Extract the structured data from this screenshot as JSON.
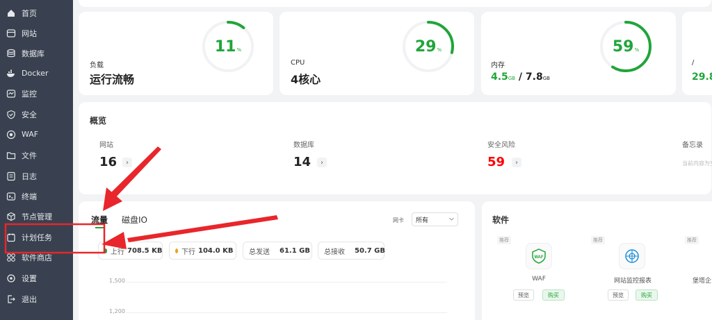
{
  "sidebar": {
    "items": [
      {
        "label": "首页",
        "icon": "home-icon"
      },
      {
        "label": "网站",
        "icon": "globe-icon"
      },
      {
        "label": "数据库",
        "icon": "database-icon"
      },
      {
        "label": "Docker",
        "icon": "docker-icon"
      },
      {
        "label": "监控",
        "icon": "monitor-icon"
      },
      {
        "label": "安全",
        "icon": "shield-icon"
      },
      {
        "label": "WAF",
        "icon": "firewall-icon"
      },
      {
        "label": "文件",
        "icon": "folder-icon"
      },
      {
        "label": "日志",
        "icon": "log-icon"
      },
      {
        "label": "终端",
        "icon": "terminal-icon"
      },
      {
        "label": "节点管理",
        "icon": "node-icon"
      },
      {
        "label": "计划任务",
        "icon": "task-icon"
      },
      {
        "label": "软件商店",
        "icon": "store-icon"
      },
      {
        "label": "设置",
        "icon": "gear-icon"
      },
      {
        "label": "退出",
        "icon": "logout-icon"
      }
    ]
  },
  "stats": {
    "load": {
      "label": "负载",
      "value": "运行流畅",
      "percent": "11",
      "unit": "%",
      "ratio": 0.11
    },
    "cpu": {
      "label": "CPU",
      "value": "4核心",
      "percent": "29",
      "unit": "%",
      "ratio": 0.29
    },
    "memory": {
      "label": "内存",
      "used": "4.5",
      "used_unit": "GB",
      "sep": " / ",
      "total": "7.8",
      "total_unit": "GB",
      "percent": "59",
      "unit": "%",
      "ratio": 0.59
    },
    "disk": {
      "label": "/",
      "value": "29.8"
    }
  },
  "overview": {
    "title": "概览",
    "items": [
      {
        "label": "网站",
        "value": "16"
      },
      {
        "label": "数据库",
        "value": "14"
      },
      {
        "label": "安全风险",
        "value": "59"
      },
      {
        "label": "备忘录",
        "hint": "当前内容为空"
      }
    ],
    "chevron": "›"
  },
  "traffic": {
    "tabs": [
      "流量",
      "磁盘IO"
    ],
    "nic_label": "网卡",
    "nic_value": "所有",
    "up_label": "上行",
    "up_value": "708.5 KB",
    "down_label": "下行",
    "down_value": "104.0 KB",
    "sent_label": "总发送",
    "sent_value": "61.1 GB",
    "recv_label": "总接收",
    "recv_value": "50.7 GB",
    "y_ticks": [
      "1,500",
      "1,200"
    ]
  },
  "software": {
    "title": "软件",
    "badge": "推荐",
    "items": [
      {
        "name": "WAF",
        "icon_text": "WAF"
      },
      {
        "name": "网站监控报表"
      },
      {
        "name": "堡塔企"
      }
    ],
    "preview_label": "预览",
    "buy_label": "购买"
  },
  "colors": {
    "sidebar_bg": "#394150",
    "accent_green": "#20a53a",
    "risk_red": "#ff0000",
    "annotation_red": "#e8262b",
    "upload_dot": "#20a53a",
    "download_dot": "#f0a020"
  }
}
